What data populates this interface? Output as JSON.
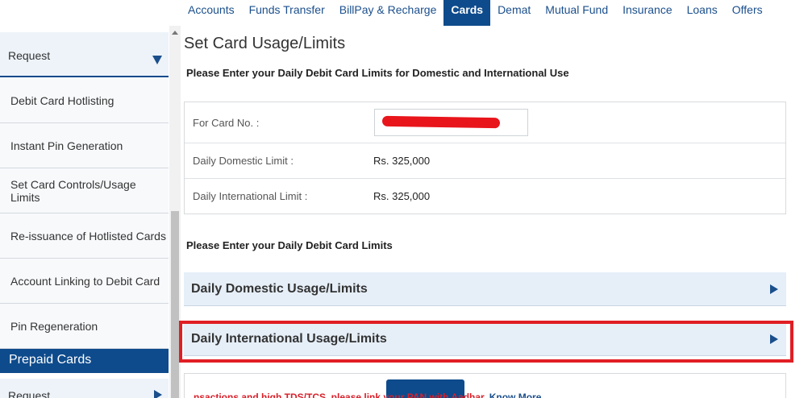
{
  "nav": {
    "items": [
      "Accounts",
      "Funds Transfer",
      "BillPay & Recharge",
      "Cards",
      "Demat",
      "Mutual Fund",
      "Insurance",
      "Loans",
      "Offers"
    ],
    "active": "Cards"
  },
  "sidebar": {
    "request_label": "Request",
    "items": [
      "Debit Card Hotlisting",
      "Instant Pin Generation",
      "Set Card Controls/Usage Limits",
      "Re-issuance of Hotlisted Cards",
      "Account Linking to Debit Card",
      "Pin Regeneration"
    ],
    "prepaid_label": "Prepaid Cards",
    "request2_label": "Request"
  },
  "main": {
    "title": "Set Card Usage/Limits",
    "subtitle": "Please Enter your Daily Debit Card Limits for Domestic and International Use",
    "card_no_label": "For Card No. :",
    "domestic_limit_label": "Daily Domestic Limit :",
    "domestic_limit_value": "Rs. 325,000",
    "international_limit_label": "Daily International Limit :",
    "international_limit_value": "Rs. 325,000",
    "subtitle2": "Please Enter your Daily Debit Card Limits",
    "domestic_section": "Daily Domestic Usage/Limits",
    "international_section": "Daily International Usage/Limits"
  },
  "ticker": {
    "text": "nsactions and high TDS/TCS, please link your PAN with Aadhar. ",
    "more": "Know More"
  },
  "colors": {
    "primary": "#0e4b8c",
    "accordion_bg": "#e6eff8",
    "highlight": "#e01e24",
    "redaction": "#e8151b"
  }
}
